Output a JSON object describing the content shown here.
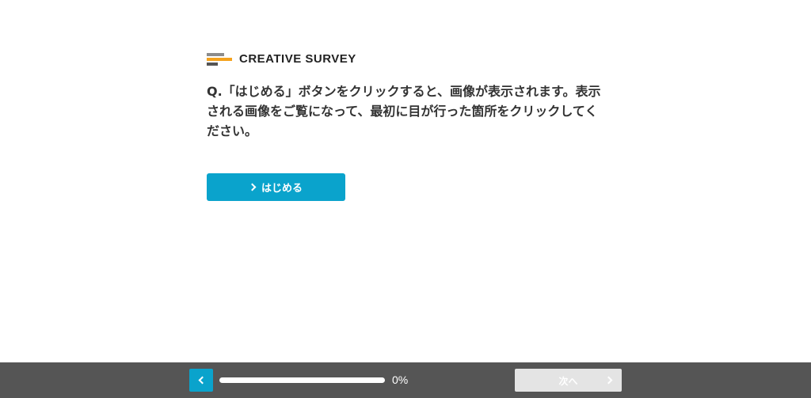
{
  "logo": {
    "text": "CREATIVE SURVEY"
  },
  "question": {
    "text": "Q.「はじめる」ボタンをクリックすると、画像が表示されます。表示される画像をご覧になって、最初に目が行った箇所をクリックしてください。"
  },
  "start_button": {
    "label": "はじめる",
    "icon": "chevron-right-icon",
    "color": "#0aa3cc"
  },
  "footer": {
    "background": "#555555",
    "back_button": {
      "icon": "chevron-left-icon"
    },
    "progress": {
      "value": 0,
      "label": "0%"
    },
    "next_button": {
      "label": "次へ",
      "icon": "chevron-right-icon",
      "enabled": false
    }
  }
}
